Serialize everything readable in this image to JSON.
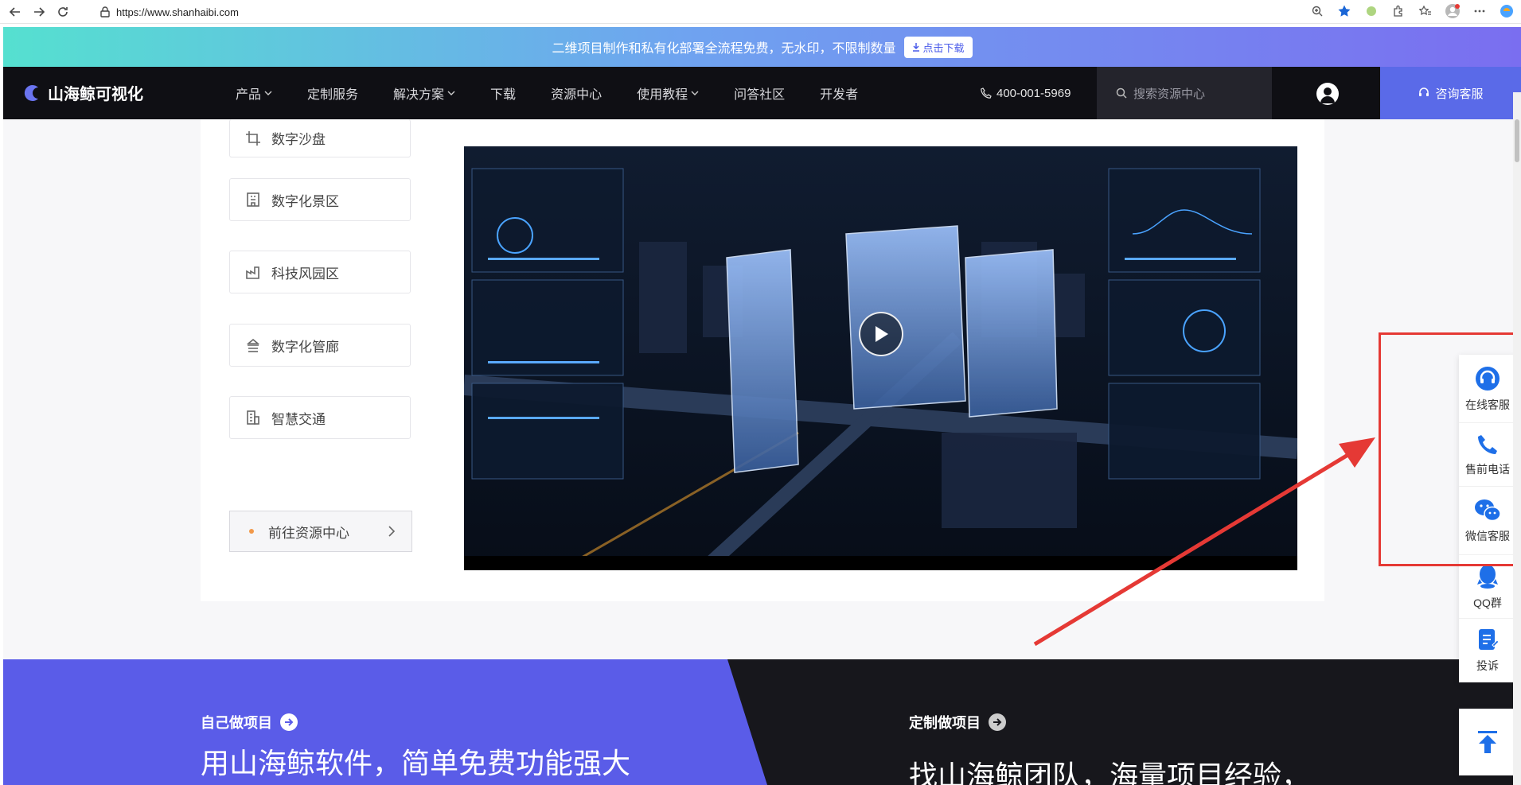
{
  "browser": {
    "url": "https://www.shanhaibi.com"
  },
  "promo": {
    "text": "二维项目制作和私有化部署全流程免费，无水印，不限制数量",
    "button": "点击下载"
  },
  "nav": {
    "logo": "山海鲸可视化",
    "items": [
      {
        "label": "产品",
        "dropdown": true
      },
      {
        "label": "定制服务",
        "dropdown": false
      },
      {
        "label": "解决方案",
        "dropdown": true
      },
      {
        "label": "下载",
        "dropdown": false
      },
      {
        "label": "资源中心",
        "dropdown": false
      },
      {
        "label": "使用教程",
        "dropdown": true
      },
      {
        "label": "问答社区",
        "dropdown": false
      },
      {
        "label": "开发者",
        "dropdown": false
      }
    ],
    "phone": "400-001-5969",
    "search_placeholder": "搜索资源中心",
    "consult": "咨询客服"
  },
  "sidebar": {
    "items": [
      {
        "label": "数字沙盘",
        "icon": "crop-icon"
      },
      {
        "label": "数字化景区",
        "icon": "building-icon"
      },
      {
        "label": "科技风园区",
        "icon": "factory-icon"
      },
      {
        "label": "数字化管廊",
        "icon": "pipeline-icon"
      },
      {
        "label": "智慧交通",
        "icon": "city-icon"
      }
    ],
    "goto": "前往资源中心"
  },
  "video": {
    "label": "园区可视化演示视频"
  },
  "hero": {
    "left_label": "自己做项目",
    "left_title": "用山海鲸软件，简单免费功能强大",
    "right_label": "定制做项目",
    "right_title": "找山海鲸团队，海量项目经验，"
  },
  "float": {
    "items": [
      {
        "label": "在线客服",
        "icon": "headset-icon"
      },
      {
        "label": "售前电话",
        "icon": "phone-icon"
      },
      {
        "label": "微信客服",
        "icon": "wechat-icon"
      },
      {
        "label": "QQ群",
        "icon": "qq-icon"
      },
      {
        "label": "投诉",
        "icon": "complaint-icon"
      }
    ]
  },
  "colors": {
    "accent": "#5a6ae8",
    "nav_bg": "#0f0f14",
    "highlight": "#e53935",
    "float_icon": "#1e6fe8"
  }
}
